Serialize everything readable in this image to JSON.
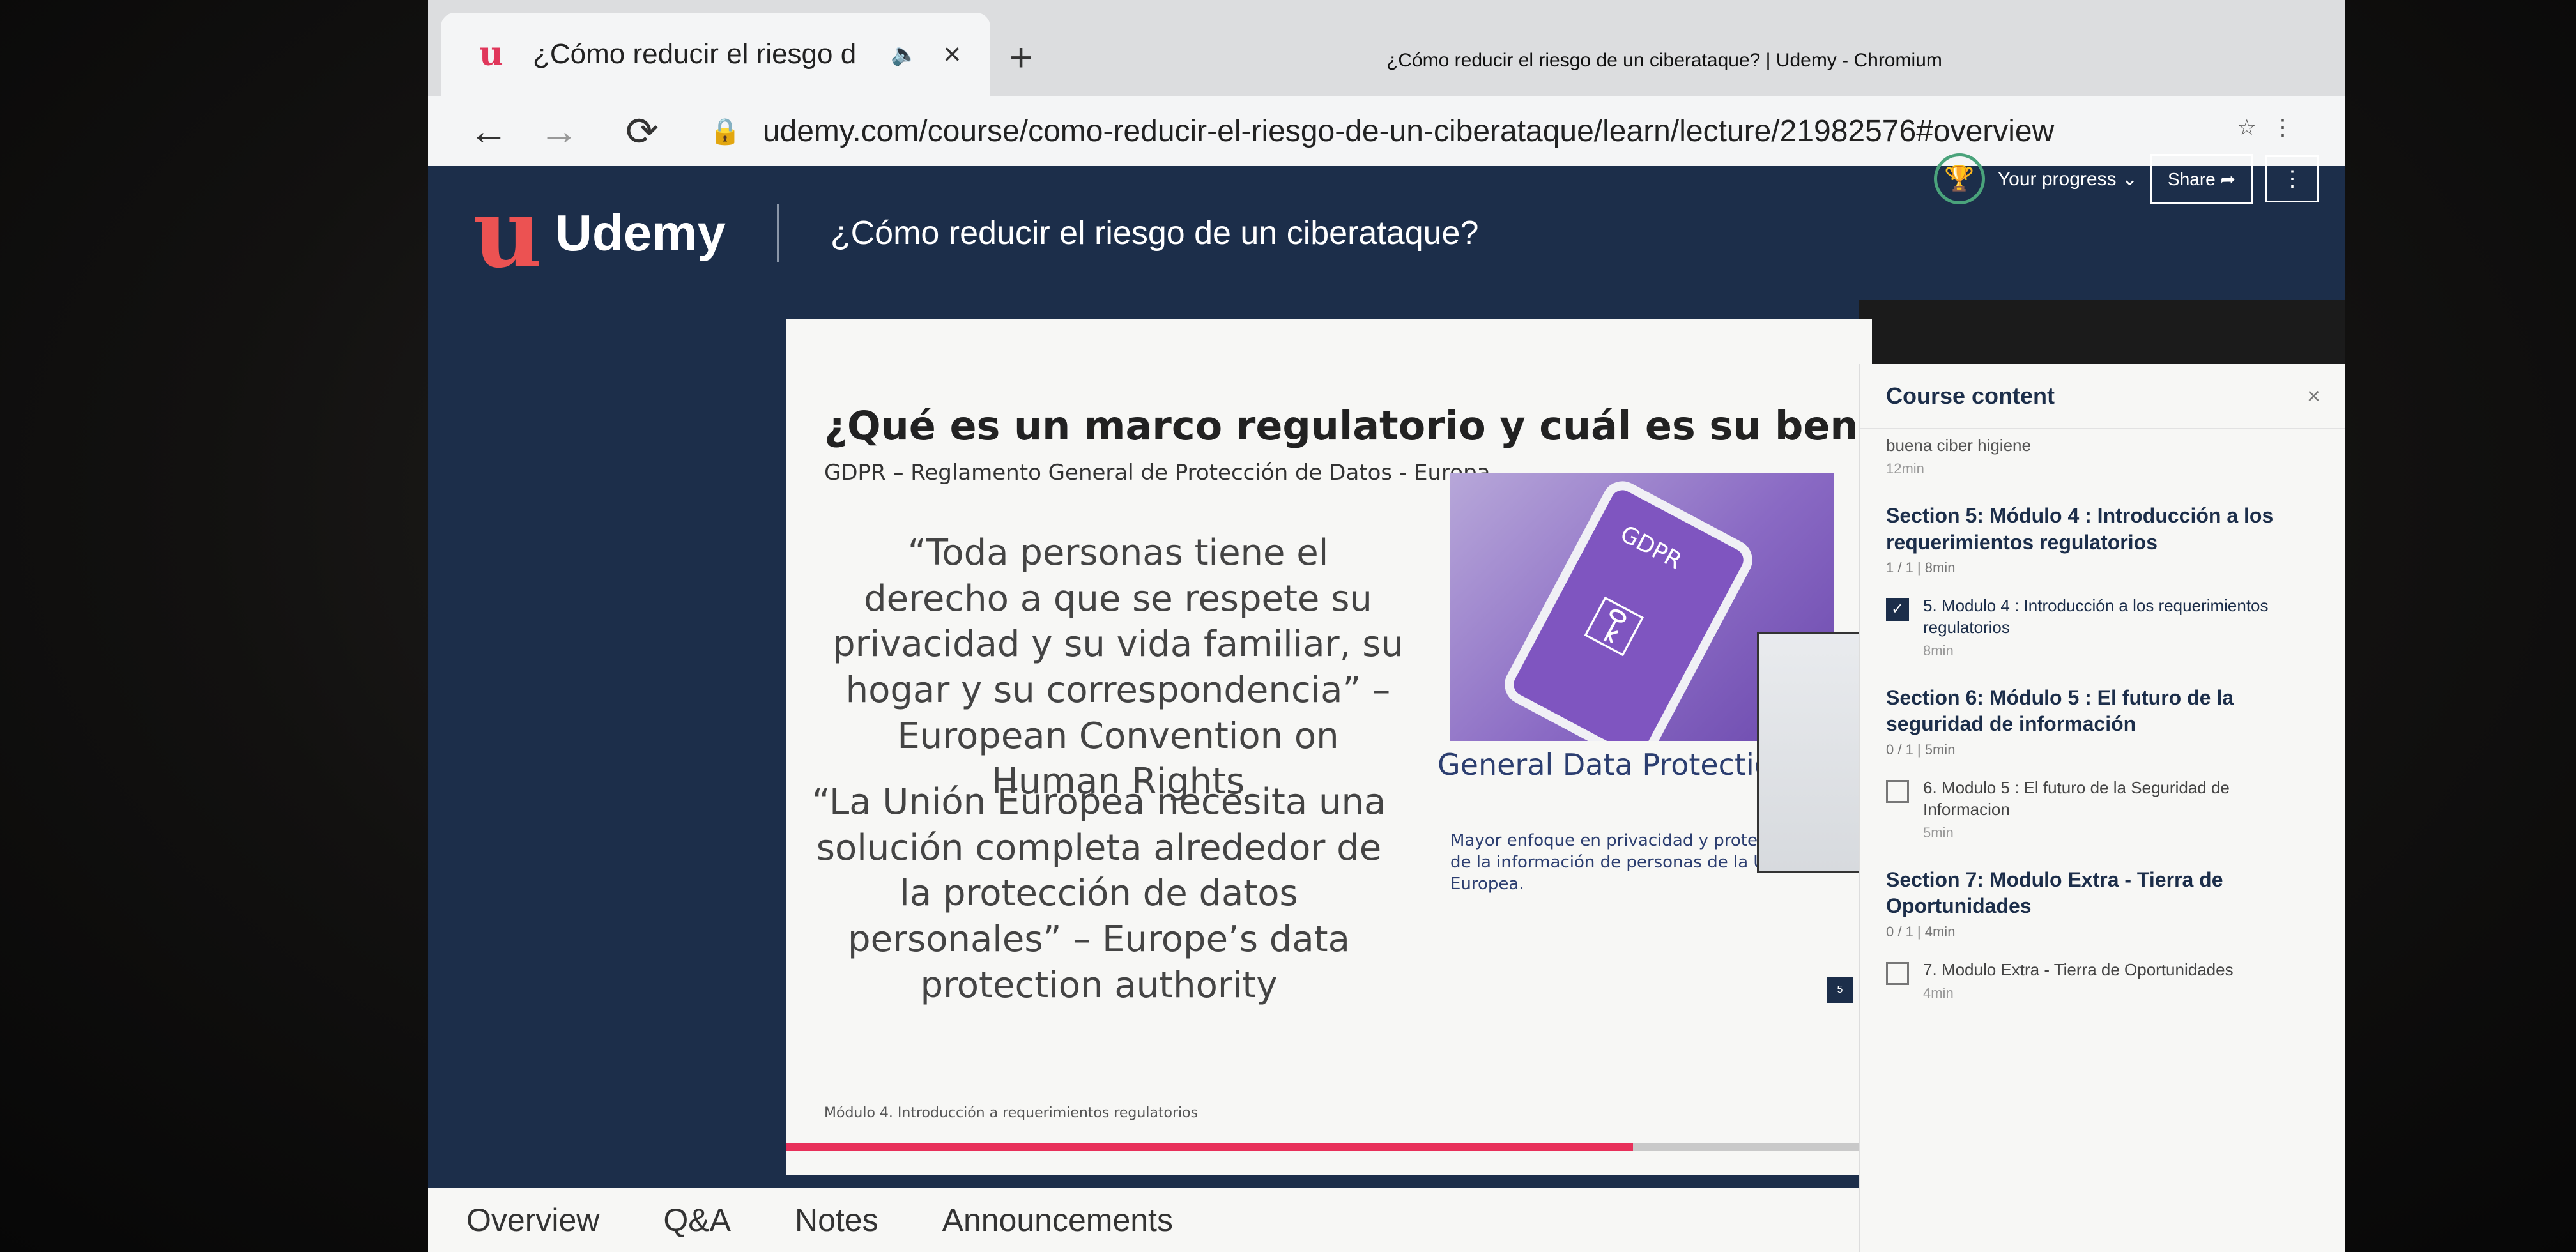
{
  "browser": {
    "tab_title": "¿Cómo reducir el riesgo d",
    "tab_favicon": "u",
    "sound_icon": "🔈",
    "close_icon": "×",
    "new_tab": "+",
    "window_title": "¿Cómo reducir el riesgo de un ciberataque? | Udemy - Chromium",
    "url": "udemy.com/course/como-reducir-el-riesgo-de-un-ciberataque/learn/lecture/21982576#overview",
    "icons": {
      "back": "←",
      "forward": "→",
      "reload": "⟳",
      "lock": "🔒",
      "star": "☆",
      "menu": "⋮"
    }
  },
  "header": {
    "logo_text": "Udemy",
    "course_title": "¿Cómo reducir el riesgo de un ciberataque?",
    "progress_label": "Your progress ⌄",
    "share_label": "Share ➦",
    "more_label": "⋮",
    "trophy_icon": "🏆"
  },
  "slide": {
    "heading": "¿Qué es un marco regulatorio y cuál es su beneficio?",
    "subheading": "GDPR – Reglamento General de Protección de Datos - Europa",
    "quote1": "“Toda personas tiene el derecho a que se respete su privacidad y su vida familiar, su hogar y su correspondencia” – European Convention on Human Rights",
    "quote2": "“La Unión Europea necesita una solución completa alrededor de la protección de datos personales” – Europe’s data protection authority",
    "phone_label": "GDPR",
    "image_caption": "General Data Protection Regulation",
    "image_note": "Mayor enfoque en privacidad y protección de la información de personas de la Unión Europea.",
    "footer": "Módulo 4. Introducción a requerimientos regulatorios",
    "page_number": "5",
    "progress": 0.78
  },
  "bottom_tabs": [
    "Overview",
    "Q&A",
    "Notes",
    "Announcements"
  ],
  "sidebar": {
    "title": "Course content",
    "close": "×",
    "prev_lecture": {
      "title": "buena ciber higiene",
      "duration": "12min"
    },
    "sections": [
      {
        "title": "Section 5: Módulo 4 : Introducción a los requerimientos regulatorios",
        "meta": "1 / 1 | 8min",
        "lecture": {
          "title": "5. Modulo 4 : Introducción a los requerimientos regulatorios",
          "duration": "8min",
          "checked": true
        }
      },
      {
        "title": "Section 6: Módulo 5 : El futuro de la seguridad de información",
        "meta": "0 / 1 | 5min",
        "lecture": {
          "title": "6. Modulo 5 : El futuro de la Seguridad de Informacion",
          "duration": "5min",
          "checked": false
        }
      },
      {
        "title": "Section 7: Modulo Extra - Tierra de Oportunidades",
        "meta": "0 / 1 | 4min",
        "lecture": {
          "title": "7. Modulo Extra - Tierra de Oportunidades",
          "duration": "4min",
          "checked": false
        }
      }
    ]
  }
}
